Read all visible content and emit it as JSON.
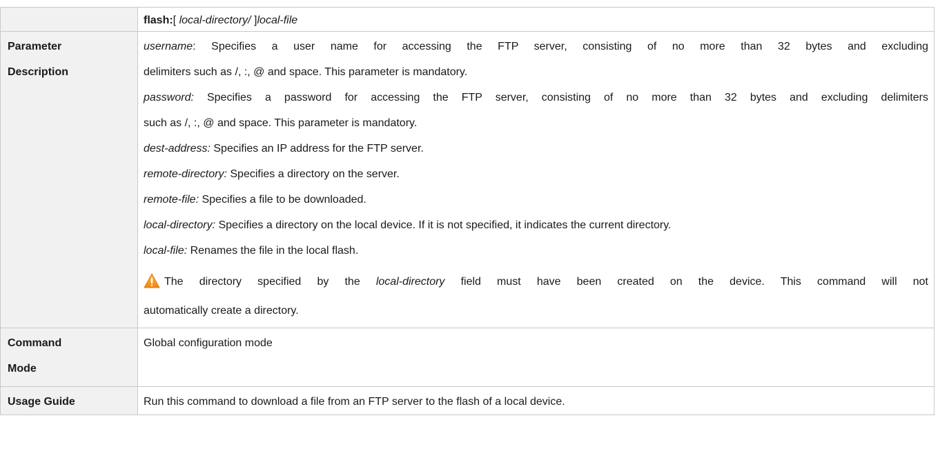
{
  "top_row": {
    "prefix": "flash:",
    "open_bracket": "[ ",
    "local_directory": "local-directory/",
    "close_bracket": " ]",
    "local_file": "local-file"
  },
  "parameter_description": {
    "label_line1": "Parameter",
    "label_line2": "Description",
    "params": [
      {
        "name": "username",
        "sep": ":",
        "line1": " Specifies a user name for accessing the FTP server, consisting of no more than 32 bytes and excluding",
        "line2": "delimiters such as /, :, @ and space. This parameter is mandatory."
      },
      {
        "name": "password:",
        "line1": " Specifies a password for accessing the FTP server, consisting of no more than 32 bytes and excluding delimiters",
        "line2": "such as /, :, @ and space. This parameter is mandatory."
      },
      {
        "name": "dest-address:",
        "text": " Specifies an IP address for the FTP server."
      },
      {
        "name": "remote-directory:",
        "text": " Specifies a directory on the server."
      },
      {
        "name": "remote-file:",
        "text": " Specifies a file to be downloaded."
      },
      {
        "name": "local-directory:",
        "text": " Specifies a directory on the local device. If it is not specified, it indicates the current directory."
      },
      {
        "name": "local-file:",
        "text": " Renames the file in the local flash."
      }
    ],
    "warning": {
      "icon": "warning-triangle-icon",
      "before": "The directory specified by the ",
      "field": "local-directory",
      "after": " field must have been created on the device. This command will not",
      "line2": "automatically create a directory."
    }
  },
  "command_mode": {
    "label_line1": "Command",
    "label_line2": "Mode",
    "value": "Global configuration mode"
  },
  "usage_guide": {
    "label": "Usage Guide",
    "value": "Run this command to download a file from an FTP server to the flash of a local device."
  },
  "colors": {
    "label_bg": "#f1f1f1",
    "border": "#c8c8c8",
    "warning_orange": "#f39a1e"
  }
}
